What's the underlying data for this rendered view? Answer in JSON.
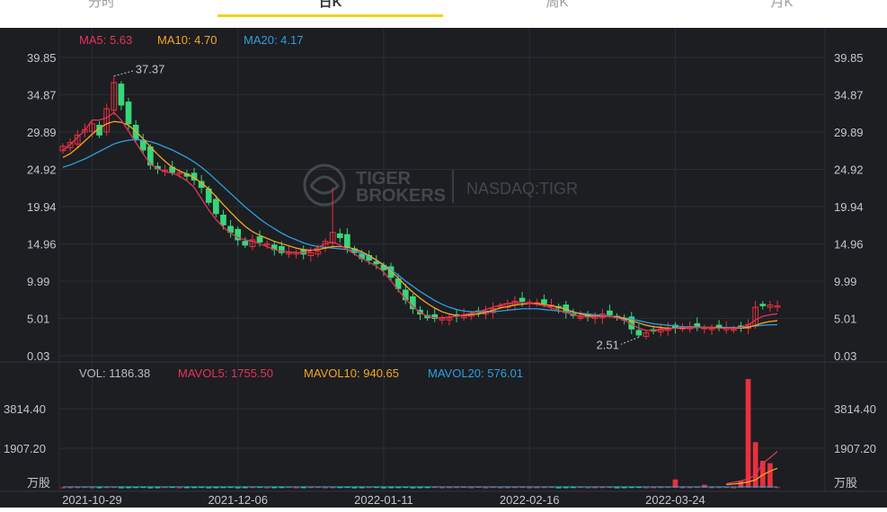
{
  "tabs": [
    {
      "label": "分时",
      "active": false
    },
    {
      "label": "日K",
      "active": true
    },
    {
      "label": "周K",
      "active": false
    },
    {
      "label": "月K",
      "active": false
    }
  ],
  "watermark": {
    "line1": "TIGER",
    "line2": "BROKERS",
    "exchange": "NASDAQ:TIGR"
  },
  "colors": {
    "up": "#e8313c",
    "down": "#37d67a",
    "ma5": "#e8325a",
    "ma10": "#f5a623",
    "ma20": "#2d9fe0",
    "bg": "#1c1e22",
    "accent": "#f2d21b"
  },
  "chart_data": {
    "type": "candlestick",
    "price_panel": {
      "legend": [
        {
          "label": "MA5:",
          "value": "5.63",
          "color": "#e8325a"
        },
        {
          "label": "MA10:",
          "value": "4.70",
          "color": "#f5a623"
        },
        {
          "label": "MA20:",
          "value": "4.17",
          "color": "#2d9fe0"
        }
      ],
      "y_ticks": [
        "39.85",
        "34.87",
        "29.89",
        "24.92",
        "19.94",
        "14.96",
        "9.99",
        "5.01",
        "0.03"
      ],
      "ylim": [
        0.03,
        39.85
      ],
      "annotations": [
        {
          "text": "37.37",
          "value": 37.37,
          "type": "high"
        },
        {
          "text": "2.51",
          "value": 2.51,
          "type": "low"
        }
      ],
      "close_trajectory": [
        28,
        28.5,
        29.5,
        30.2,
        31,
        29.5,
        33,
        36.5,
        33.5,
        31,
        29,
        27.5,
        25.5,
        25,
        24.8,
        24.5,
        24.5,
        24,
        23.5,
        22.5,
        20.5,
        19,
        17.5,
        16.5,
        15.5,
        14.8,
        15.5,
        15.2,
        15,
        14.2,
        13.8,
        13.8,
        13.8,
        13.6,
        13.8,
        14,
        15.3,
        16.5,
        15.8,
        14.5,
        13.8,
        13,
        12.8,
        12.3,
        11.5,
        10.5,
        9,
        7.5,
        6.3,
        5.6,
        5.1,
        5,
        5,
        5.1,
        5.3,
        5.5,
        5.6,
        5.8,
        6,
        6.3,
        6.7,
        7,
        7.3,
        7.3,
        7.2,
        7.1,
        7,
        6.8,
        6.4,
        5.8,
        5.4,
        5.2,
        5.2,
        5.3,
        5.6,
        5.5,
        5.2,
        4.8,
        3.6,
        2.8,
        3.1,
        3.4,
        3.6,
        3.7,
        3.8,
        3.8,
        3.9,
        3.9,
        3.8,
        3.7,
        3.7,
        3.8,
        3.6,
        3.9,
        4.2,
        6.5,
        6.7,
        6.8,
        6.7
      ],
      "ma5": [
        27.5,
        28.2,
        29.2,
        30.1,
        31.5,
        31.5,
        31.8,
        32.5,
        31.5,
        30,
        28.5,
        27,
        25.6,
        25,
        24.6,
        24.4,
        24,
        23.4,
        22.5,
        21,
        19.5,
        18.2,
        17.2,
        16.4,
        15.8,
        15.5,
        15.3,
        15,
        14.6,
        14.2,
        14,
        13.9,
        13.8,
        13.8,
        14,
        14.5,
        15,
        15.2,
        14.8,
        14.2,
        13.6,
        13,
        12.5,
        12,
        11.2,
        10,
        8.8,
        7.6,
        6.6,
        5.8,
        5.3,
        5.1,
        5.1,
        5.2,
        5.3,
        5.5,
        5.7,
        5.9,
        6.2,
        6.5,
        6.8,
        7,
        7.1,
        7.1,
        7,
        6.9,
        6.7,
        6.4,
        6.1,
        5.8,
        5.5,
        5.3,
        5.2,
        5.2,
        5.3,
        5.3,
        5.1,
        4.8,
        4.2,
        3.7,
        3.4,
        3.4,
        3.5,
        3.6,
        3.7,
        3.8,
        3.8,
        3.8,
        3.8,
        3.8,
        3.7,
        3.7,
        3.7,
        3.8,
        4.1,
        4.8,
        5.3,
        5.5,
        5.63
      ],
      "ma10": [
        26.5,
        27,
        27.8,
        28.7,
        29.6,
        30.4,
        31,
        31.3,
        31.2,
        30.8,
        30,
        29,
        27.9,
        26.9,
        26,
        25.2,
        24.7,
        24.3,
        23.8,
        23.1,
        22.3,
        21.3,
        20.2,
        19.2,
        18.2,
        17.3,
        16.6,
        16.1,
        15.7,
        15.3,
        15,
        14.7,
        14.4,
        14.2,
        14.1,
        14.2,
        14.4,
        14.6,
        14.6,
        14.5,
        14.3,
        13.9,
        13.4,
        12.8,
        12.1,
        11.3,
        10.4,
        9.4,
        8.5,
        7.7,
        7,
        6.4,
        5.9,
        5.6,
        5.4,
        5.4,
        5.5,
        5.6,
        5.8,
        6.1,
        6.4,
        6.6,
        6.8,
        6.9,
        7,
        7,
        6.9,
        6.7,
        6.5,
        6.2,
        5.9,
        5.6,
        5.4,
        5.3,
        5.3,
        5.3,
        5.2,
        5,
        4.7,
        4.4,
        4.1,
        3.9,
        3.8,
        3.7,
        3.7,
        3.7,
        3.8,
        3.8,
        3.8,
        3.8,
        3.8,
        3.7,
        3.7,
        3.7,
        3.8,
        4.1,
        4.4,
        4.6,
        4.7
      ],
      "ma20": [
        25.2,
        25.5,
        25.9,
        26.3,
        26.8,
        27.3,
        27.8,
        28.3,
        28.6,
        28.8,
        28.9,
        28.8,
        28.6,
        28.3,
        27.9,
        27.5,
        27,
        26.5,
        25.9,
        25.2,
        24.4,
        23.5,
        22.6,
        21.7,
        20.8,
        19.9,
        19.1,
        18.3,
        17.6,
        17,
        16.4,
        15.9,
        15.5,
        15.1,
        14.8,
        14.6,
        14.5,
        14.4,
        14.3,
        14.2,
        14,
        13.7,
        13.3,
        12.8,
        12.2,
        11.5,
        10.8,
        10,
        9.3,
        8.6,
        8,
        7.4,
        6.9,
        6.5,
        6.2,
        6,
        5.9,
        5.9,
        5.9,
        5.9,
        6,
        6.1,
        6.2,
        6.3,
        6.3,
        6.3,
        6.2,
        6.1,
        6,
        5.9,
        5.8,
        5.7,
        5.6,
        5.5,
        5.4,
        5.3,
        5.2,
        5.1,
        4.9,
        4.7,
        4.5,
        4.3,
        4.2,
        4.1,
        4,
        3.9,
        3.9,
        3.9,
        3.8,
        3.8,
        3.8,
        3.8,
        3.8,
        3.8,
        3.9,
        4,
        4.1,
        4.15,
        4.17
      ]
    },
    "volume_panel": {
      "legend": [
        {
          "label": "VOL:",
          "value": "1186.38",
          "color": "#b8bcc6"
        },
        {
          "label": "MAVOL5:",
          "value": "1755.50",
          "color": "#e8325a"
        },
        {
          "label": "MAVOL10:",
          "value": "940.65",
          "color": "#f5a623"
        },
        {
          "label": "MAVOL20:",
          "value": "576.01",
          "color": "#2d9fe0"
        }
      ],
      "y_ticks": [
        "3814.40",
        "1907.20"
      ],
      "unit": "万股",
      "ylim": [
        0,
        5721.6
      ],
      "spikes": [
        {
          "index": 57,
          "value": 40
        },
        {
          "index": 58,
          "value": 15
        },
        {
          "index": 84,
          "value": 400
        },
        {
          "index": 88,
          "value": 150
        },
        {
          "index": 93,
          "value": 330
        },
        {
          "index": 94,
          "value": 5250
        },
        {
          "index": 95,
          "value": 2200
        },
        {
          "index": 96,
          "value": 1300
        },
        {
          "index": 97,
          "value": 1186
        }
      ],
      "mavol5_tail": [
        200,
        260,
        330,
        420,
        620,
        1180,
        1450,
        1755.5
      ],
      "mavol10_tail": [
        150,
        180,
        220,
        280,
        380,
        620,
        800,
        940.65
      ]
    },
    "x_labels": [
      {
        "label": "2021-10-29",
        "index": 4
      },
      {
        "label": "2021-12-06",
        "index": 24
      },
      {
        "label": "2022-01-11",
        "index": 44
      },
      {
        "label": "2022-02-16",
        "index": 64
      },
      {
        "label": "2022-03-24",
        "index": 84
      }
    ]
  }
}
